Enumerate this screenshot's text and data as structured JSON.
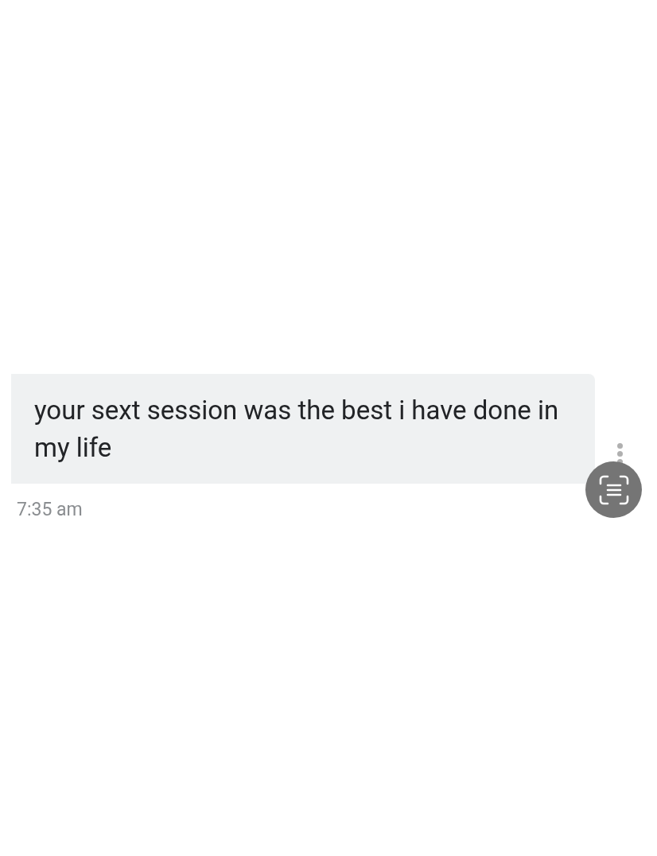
{
  "message": {
    "text": "your sext session was the best i have done in my life",
    "time": "7:35 am"
  }
}
